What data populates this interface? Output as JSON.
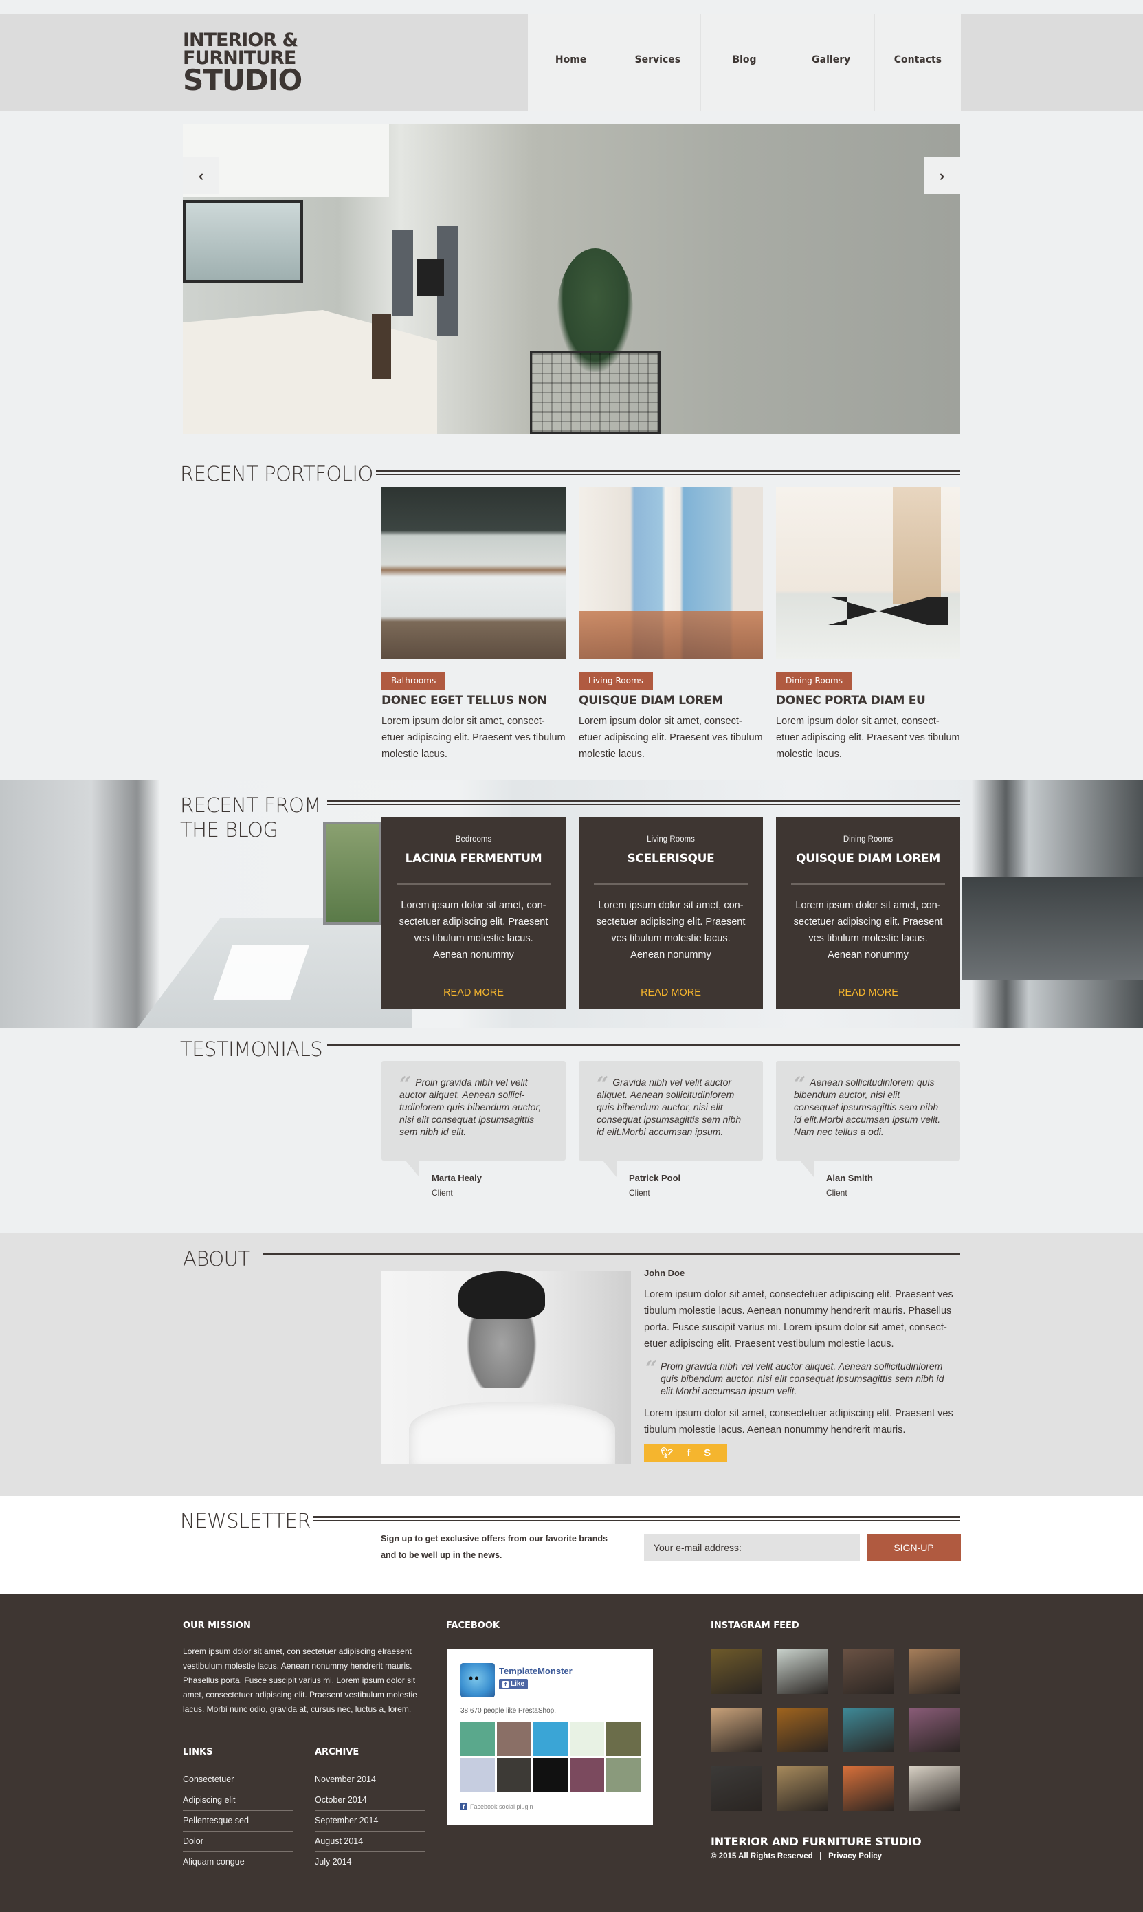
{
  "header": {
    "logo": {
      "line1": "INTERIOR &",
      "line2": "FURNITURE",
      "line3": "STUDIO"
    },
    "nav": [
      {
        "label": "Home"
      },
      {
        "label": "Services"
      },
      {
        "label": "Blog"
      },
      {
        "label": "Gallery"
      },
      {
        "label": "Contacts"
      }
    ]
  },
  "slider": {
    "prev_icon": "chevron-left-icon",
    "next_icon": "chevron-right-icon",
    "prev_glyph": "‹",
    "next_glyph": "›"
  },
  "portfolio": {
    "title": "RECENT PORTFOLIO",
    "items": [
      {
        "tag": "Bathrooms",
        "title": "DONEC EGET TELLUS NON",
        "text": "Lorem ipsum dolor sit amet, consect-etuer adipiscing elit. Praesent ves tibulum molestie lacus."
      },
      {
        "tag": "Living Rooms",
        "title": "QUISQUE DIAM LOREM",
        "text": "Lorem ipsum dolor sit amet, consect-etuer adipiscing elit. Praesent ves tibulum molestie lacus."
      },
      {
        "tag": "Dining Rooms",
        "title": "DONEC PORTA DIAM EU",
        "text": "Lorem ipsum dolor sit amet, consect-etuer adipiscing elit. Praesent ves tibulum molestie lacus."
      }
    ]
  },
  "blog": {
    "title_line1": "RECENT FROM",
    "title_line2": "THE BLOG",
    "items": [
      {
        "category": "Bedrooms",
        "title": "LACINIA FERMENTUM",
        "text": "Lorem ipsum dolor sit amet, con-sectetuer adipiscing elit. Praesent ves tibulum molestie lacus. Aenean nonummy",
        "link": "READ MORE"
      },
      {
        "category": "Living Rooms",
        "title": "SCELERISQUE",
        "text": "Lorem ipsum dolor sit amet, con-sectetuer adipiscing elit. Praesent ves tibulum molestie lacus. Aenean nonummy",
        "link": "READ MORE"
      },
      {
        "category": "Dining Rooms",
        "title": "QUISQUE DIAM LOREM",
        "text": "Lorem ipsum dolor sit amet, con-sectetuer adipiscing elit. Praesent ves tibulum molestie lacus. Aenean nonummy",
        "link": "READ MORE"
      }
    ]
  },
  "testimonials": {
    "title": "TESTIMONIALS",
    "quote_glyph": "“",
    "items": [
      {
        "quote": "Proin gravida nibh vel velit auctor aliquet. Aenean sollici-tudinlorem quis bibendum auctor, nisi elit consequat ipsumsagittis sem nibh id elit.",
        "name": "Marta Healy",
        "role": "Client"
      },
      {
        "quote": "Gravida nibh vel velit auctor aliquet. Aenean sollicitudinlorem quis bibendum auctor, nisi elit consequat ipsumsagittis sem nibh id elit.Morbi accumsan ipsum.",
        "name": "Patrick Pool",
        "role": "Client"
      },
      {
        "quote": "Aenean sollicitudinlorem quis bibendum auctor, nisi elit consequat ipsumsagittis sem nibh id elit.Morbi accumsan ipsum velit. Nam nec tellus a odi.",
        "name": "Alan Smith",
        "role": "Client"
      }
    ]
  },
  "about": {
    "title": "ABOUT",
    "name": "John Doe",
    "paragraph1": "Lorem ipsum dolor sit amet, consectetuer adipiscing elit. Praesent ves tibulum molestie lacus. Aenean nonummy hendrerit mauris. Phasellus porta. Fusce suscipit varius mi. Lorem ipsum dolor sit amet, consect-etuer adipiscing elit. Praesent vestibulum molestie lacus.",
    "quote": "Proin gravida nibh vel velit auctor aliquet. Aenean sollicitudinlorem quis bibendum auctor, nisi elit consequat ipsumsagittis sem nibh id elit.Morbi accumsan ipsum velit.",
    "paragraph2": "Lorem ipsum dolor sit amet, consectetuer adipiscing elit. Praesent ves tibulum molestie lacus. Aenean nonummy hendrerit mauris.",
    "social": [
      {
        "icon": "twitter-icon",
        "glyph": "🐦︎"
      },
      {
        "icon": "facebook-icon",
        "glyph": "f"
      },
      {
        "icon": "skype-icon",
        "glyph": "S"
      }
    ]
  },
  "newsletter": {
    "title": "NEWSLETTER",
    "text": "Sign up to get exclusive offers from our favorite brands and to be well up in the news.",
    "input_placeholder": "Your e-mail address:",
    "button": "SIGN-UP"
  },
  "footer": {
    "mission_title": "OUR MISSION",
    "mission_text": "Lorem ipsum dolor sit amet, con sectetuer adipiscing elraesent vestibulum molestie lacus. Aenean nonummy hendrerit mauris. Phasellus porta. Fusce suscipit varius mi. Lorem ipsum dolor sit amet, consectetuer adipiscing elit. Praesent vestibulum molestie lacus. Morbi nunc odio, gravida at, cursus nec, luctus a, lorem.",
    "links_title": "LINKS",
    "links": [
      "Consectetuer",
      "Adipiscing elit",
      "Pellentesque sed",
      "Dolor",
      "Aliquam congue"
    ],
    "archive_title": "ARCHIVE",
    "archive": [
      "November 2014",
      "October 2014",
      "September 2014",
      "August 2014",
      "July 2014"
    ],
    "facebook_title": "FACEBOOK",
    "facebook": {
      "page_name": "TemplateMonster",
      "like_label": "Like",
      "count_text": "38,670 people like PrestaShop.",
      "plugin_text": "Facebook social plugin",
      "faces": [
        "#5aa88c",
        "#8a6f66",
        "#3aa5d6",
        "#e8f2e4",
        "#6b6d4a",
        "#c6cde0",
        "#3d3a36",
        "#111111",
        "#7b4a5e",
        "#8a9a7c"
      ]
    },
    "instagram_title": "INSTAGRAM FEED",
    "instagram": [
      "#6e5a2a",
      "#c9d2cc",
      "#6a5244",
      "#a67e5a",
      "#c9a27a",
      "#a0641e",
      "#3e8a98",
      "#8a5c78",
      "#3c3a38",
      "#a78a5c",
      "#d8703a",
      "#d9d2c6"
    ],
    "brand": "INTERIOR AND FURNITURE STUDIO",
    "copyright": "© 2015 All Rights Reserved",
    "separator": "|",
    "privacy": "Privacy Policy"
  },
  "colors": {
    "accent_rust": "#b05a40",
    "accent_yellow": "#f5b52e",
    "dark_brown": "#3e3632",
    "page_bg": "#eef0f1"
  }
}
